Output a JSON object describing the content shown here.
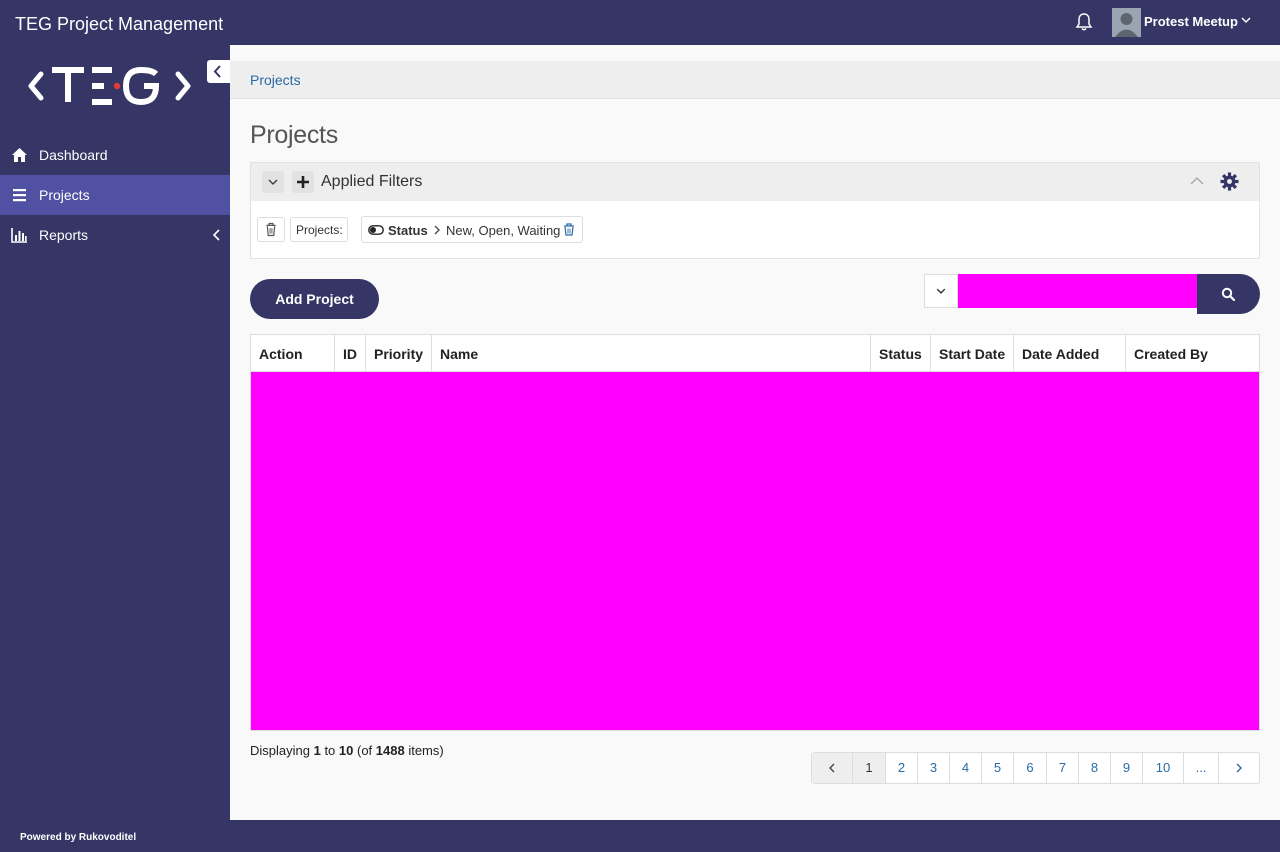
{
  "header": {
    "app_title": "TEG Project Management",
    "user_name": "Protest Meetup"
  },
  "sidebar": {
    "logo_text": "<TEG>",
    "items": [
      {
        "label": "Dashboard",
        "icon": "home-icon",
        "active": false
      },
      {
        "label": "Projects",
        "icon": "list-icon",
        "active": true
      },
      {
        "label": "Reports",
        "icon": "bar-chart-icon",
        "active": false
      }
    ],
    "footer": "Powered by Rukovoditel"
  },
  "breadcrumb": "Projects",
  "page_title": "Projects",
  "filters": {
    "title": "Applied Filters",
    "entity_label": "Projects:",
    "filter_field": "Status",
    "filter_values": "New, Open, Waiting"
  },
  "toolbar": {
    "add_label": "Add Project",
    "search_value": ""
  },
  "table": {
    "columns": [
      "Action",
      "ID",
      "Priority",
      "Name",
      "Status",
      "Start Date",
      "Date Added",
      "Created By"
    ]
  },
  "pagination": {
    "display_prefix": "Displaying ",
    "from": "1",
    "to_word": " to ",
    "to": "10",
    "of_prefix": " (of ",
    "total": "1488",
    "of_suffix": " items)",
    "pages": [
      "1",
      "2",
      "3",
      "4",
      "5",
      "6",
      "7",
      "8",
      "9",
      "10",
      "..."
    ],
    "current": "1"
  },
  "colors": {
    "brand": "#353566",
    "active_nav": "#5151a3",
    "link": "#2a6aa6",
    "redacted": "#ff00ff"
  }
}
